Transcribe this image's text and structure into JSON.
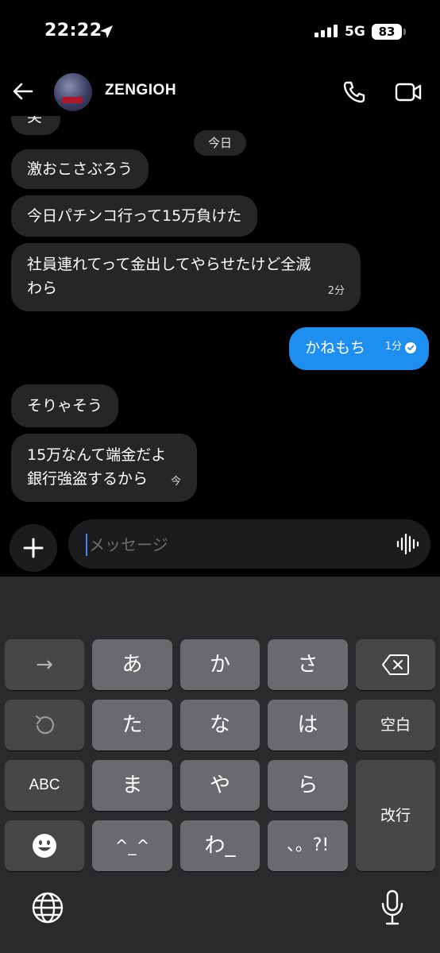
{
  "status_bar": {
    "time": "22:22",
    "network": "5G",
    "battery": "83"
  },
  "header": {
    "contact_name": "ZENGIOH"
  },
  "chat": {
    "date_chip": "今日",
    "messages": [
      {
        "direction": "received",
        "text": "笑"
      },
      {
        "direction": "received",
        "text": "激おこさぶろう"
      },
      {
        "direction": "received",
        "text": "今日パチンコ行って15万負けた"
      },
      {
        "direction": "received",
        "lines": [
          "社員連れてって金出してやらせたけど全滅",
          "わら"
        ],
        "time": "2分"
      },
      {
        "direction": "sent",
        "text": "かねもち",
        "time": "1分"
      },
      {
        "direction": "received",
        "text": "そりゃそう"
      },
      {
        "direction": "received",
        "lines": [
          "15万なんて端金だよ",
          "銀行強盗するから"
        ],
        "time": "今"
      }
    ]
  },
  "composer": {
    "placeholder": "メッセージ"
  },
  "keyboard": {
    "keys": {
      "arrow": "→",
      "a": "あ",
      "ka": "か",
      "sa": "さ",
      "ta": "た",
      "na": "な",
      "ha": "は",
      "space": "空白",
      "abc": "ABC",
      "ma": "ま",
      "ya": "や",
      "ra": "ら",
      "return": "改行",
      "kaomoji": "^_^",
      "wa": "わ_",
      "punct": "、。?!"
    }
  },
  "colors": {
    "sent_bubble": "#1f8ef1",
    "received_bubble": "#262628",
    "caret": "#4a86f0"
  }
}
